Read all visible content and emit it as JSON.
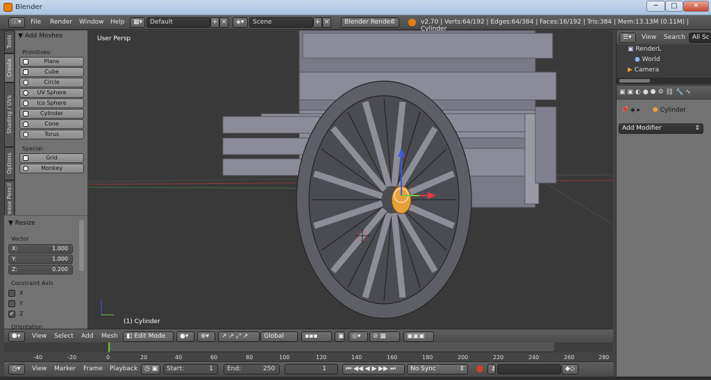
{
  "window": {
    "title": "Blender",
    "min": "─",
    "max": "□",
    "close": "✕"
  },
  "info": {
    "menus": [
      "File",
      "Render",
      "Window",
      "Help"
    ],
    "layout": "Default",
    "scene": "Scene",
    "engine": "Blender Render",
    "stats": "v2.70 | Verts:64/192 | Edges:64/384 | Faces:16/192 | Tris:384 | Mem:13.13M (0.11M) | Cylinder"
  },
  "tool_tabs": [
    "Tools",
    "Create",
    "Shading / UVs",
    "Options",
    "Grease Pencil"
  ],
  "shelf": {
    "title": "Add Meshes",
    "primitives_label": "Primitives:",
    "primitives": [
      "Plane",
      "Cube",
      "Circle",
      "UV Sphere",
      "Ico Sphere",
      "Cylinder",
      "Cone",
      "Torus"
    ],
    "special_label": "Special:",
    "special": [
      "Grid",
      "Monkey"
    ]
  },
  "redo": {
    "title": "Resize",
    "vector_label": "Vector",
    "x": {
      "label": "X:",
      "value": "1.000"
    },
    "y": {
      "label": "Y:",
      "value": "1.000"
    },
    "z": {
      "label": "Z:",
      "value": "0.200"
    },
    "constraint_label": "Constraint Axis",
    "axes": [
      {
        "label": "X",
        "checked": false
      },
      {
        "label": "Y",
        "checked": false
      },
      {
        "label": "Z",
        "checked": true
      }
    ],
    "orientation_label": "Orientation"
  },
  "viewport": {
    "view_name": "User Persp",
    "object_name": "(1) Cylinder"
  },
  "viewport_header": {
    "menus": [
      "View",
      "Select",
      "Add",
      "Mesh"
    ],
    "mode": "Edit Mode",
    "orientation": "Global"
  },
  "timeline": {
    "ticks": [
      "-40",
      "-20",
      "0",
      "20",
      "40",
      "60",
      "80",
      "100",
      "120",
      "140",
      "160",
      "180",
      "200",
      "220",
      "240",
      "260",
      "280"
    ],
    "menus": [
      "View",
      "Marker",
      "Frame",
      "Playback"
    ],
    "start": {
      "label": "Start:",
      "value": "1"
    },
    "end": {
      "label": "End:",
      "value": "250"
    },
    "current": "1",
    "sync": "No Sync"
  },
  "outliner": {
    "menus": [
      "View",
      "Search"
    ],
    "filter": "All Sc",
    "items": [
      "RenderL",
      "World",
      "Camera"
    ]
  },
  "properties": {
    "object": "Cylinder",
    "add_modifier": "Add Modifier"
  },
  "colors": {
    "background": "#393939",
    "panel": "#727272",
    "selection": "#e8a03a",
    "x_axis": "#e23b3b",
    "y_axis": "#6fc63a",
    "z_axis": "#3b5be2"
  }
}
